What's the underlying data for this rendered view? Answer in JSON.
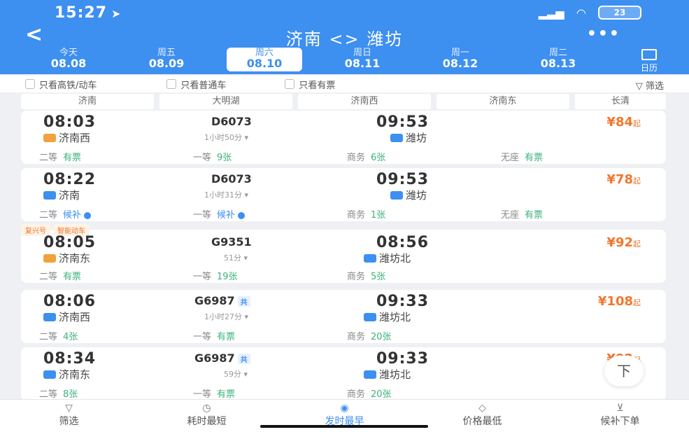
{
  "status": {
    "time": "15:27",
    "battery": "23"
  },
  "nav": {
    "back": "<",
    "title": "济南 <> 潍坊",
    "more": "•••"
  },
  "dates": [
    {
      "week": "今天",
      "date": "08.08"
    },
    {
      "week": "周五",
      "date": "08.09"
    },
    {
      "week": "周六",
      "date": "08.10"
    },
    {
      "week": "周日",
      "date": "08.11"
    },
    {
      "week": "周一",
      "date": "08.12"
    },
    {
      "week": "周二",
      "date": "08.13"
    }
  ],
  "calendar_label": "日历",
  "filters": {
    "high_speed": "只看高铁/动车",
    "normal": "只看普通车",
    "available": "只看有票",
    "filter_btn": "筛选"
  },
  "stations": [
    "济南",
    "大明湖",
    "济南西",
    "济南东",
    "长清"
  ],
  "trains": [
    {
      "dep_time": "08:03",
      "dep_station": "济南西",
      "train_no": "D6073",
      "duration": "1小时50分",
      "arr_time": "09:53",
      "arr_station": "潍坊",
      "price": "¥84",
      "price_suffix": "起",
      "seats": [
        {
          "name": "二等",
          "status": "有票"
        },
        {
          "name": "一等",
          "status": "9张"
        },
        {
          "name": "商务",
          "status": "6张"
        },
        {
          "name": "无座",
          "status": "有票"
        }
      ]
    },
    {
      "dep_time": "08:22",
      "dep_station": "济南",
      "train_no": "D6073",
      "duration": "1小时31分",
      "arr_time": "09:53",
      "arr_station": "潍坊",
      "price": "¥78",
      "price_suffix": "起",
      "seats": [
        {
          "name": "二等",
          "status": "候补"
        },
        {
          "name": "一等",
          "status": "候补"
        },
        {
          "name": "商务",
          "status": "1张"
        },
        {
          "name": "无座",
          "status": "有票"
        }
      ]
    },
    {
      "tags": [
        "复兴号",
        "智能动车"
      ],
      "dep_time": "08:05",
      "dep_station": "济南东",
      "train_no": "G9351",
      "duration": "51分",
      "arr_time": "08:56",
      "arr_station": "潍坊北",
      "price": "¥92",
      "price_suffix": "起",
      "seats": [
        {
          "name": "二等",
          "status": "有票"
        },
        {
          "name": "一等",
          "status": "19张"
        },
        {
          "name": "商务",
          "status": "5张"
        }
      ]
    },
    {
      "dep_time": "08:06",
      "dep_station": "济南西",
      "train_no": "G6987",
      "fu": "共",
      "duration": "1小时27分",
      "arr_time": "09:33",
      "arr_station": "潍坊北",
      "price": "¥108",
      "price_suffix": "起",
      "seats": [
        {
          "name": "二等",
          "status": "4张"
        },
        {
          "name": "一等",
          "status": "有票"
        },
        {
          "name": "商务",
          "status": "20张"
        }
      ]
    },
    {
      "dep_time": "08:34",
      "dep_station": "济南东",
      "train_no": "G6987",
      "fu": "共",
      "duration": "59分",
      "arr_time": "09:33",
      "arr_station": "潍坊北",
      "price": "¥92",
      "price_suffix": "起",
      "seats": [
        {
          "name": "二等",
          "status": "8张"
        },
        {
          "name": "一等",
          "status": "有票"
        },
        {
          "name": "商务",
          "status": "20张"
        }
      ]
    }
  ],
  "top_button": "下",
  "tabbar": [
    {
      "label": "筛选",
      "icon": "filter-icon"
    },
    {
      "label": "耗时最短",
      "icon": "clock-icon"
    },
    {
      "label": "发时最早",
      "icon": "circle-icon"
    },
    {
      "label": "价格最低",
      "icon": "tag-icon"
    },
    {
      "label": "候补下单",
      "icon": "cart-icon"
    }
  ],
  "colors": {
    "primary": "#3d8ff0",
    "price": "#f2762e",
    "available": "#3bb37a"
  }
}
